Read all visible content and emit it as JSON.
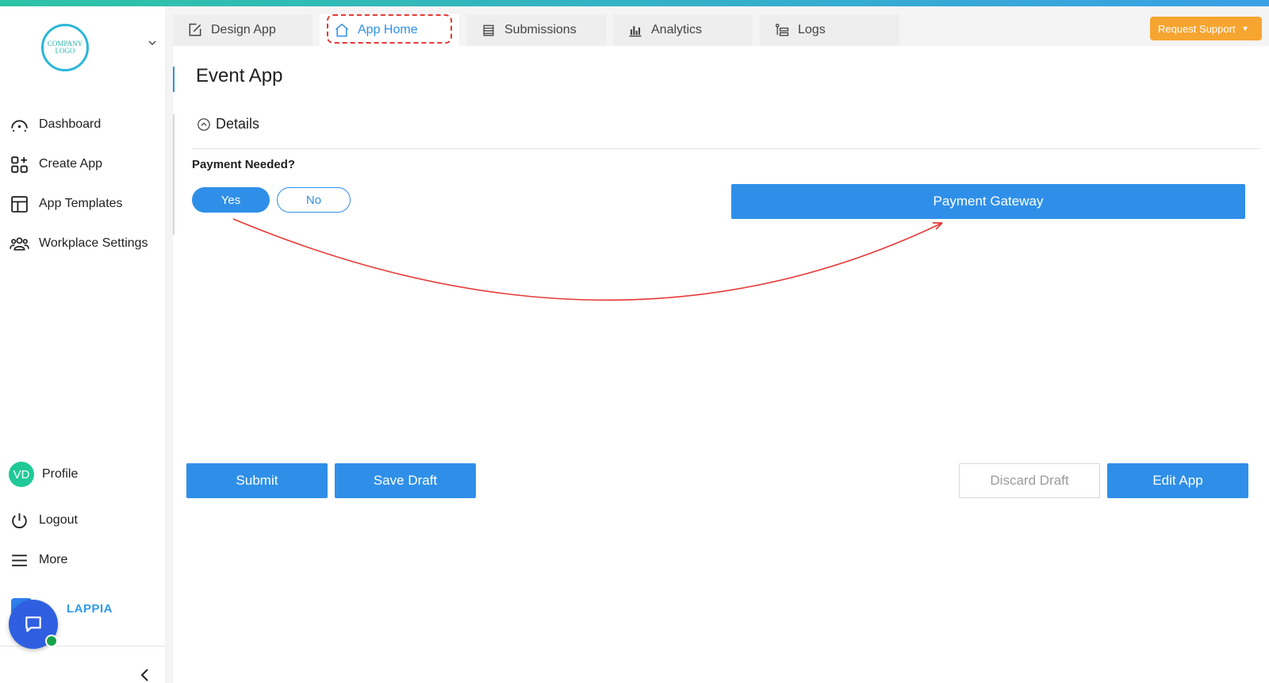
{
  "sidebar": {
    "logo_text": "COMPANY LOGO",
    "items": [
      {
        "label": "Dashboard",
        "icon": "gauge-icon"
      },
      {
        "label": "Create App",
        "icon": "grid-plus-icon"
      },
      {
        "label": "App Templates",
        "icon": "layout-template-icon"
      },
      {
        "label": "Workplace Settings",
        "icon": "users-group-icon"
      }
    ],
    "bottom_items": [
      {
        "label": "Profile",
        "avatar_initials": "VD"
      },
      {
        "label": "Logout",
        "icon": "power-icon"
      },
      {
        "label": "More",
        "icon": "hamburger-icon"
      }
    ],
    "brand": "LAPPIA"
  },
  "tabs": [
    {
      "label": "Design App",
      "icon": "edit-icon"
    },
    {
      "label": "App Home",
      "icon": "home-icon",
      "active": true
    },
    {
      "label": "Submissions",
      "icon": "list-icon"
    },
    {
      "label": "Analytics",
      "icon": "bar-chart-icon"
    },
    {
      "label": "Logs",
      "icon": "logs-icon"
    }
  ],
  "header": {
    "request_support": "Request Support"
  },
  "main": {
    "title": "Event App",
    "section": "Details",
    "field_label": "Payment Needed?",
    "yes": "Yes",
    "no": "No",
    "gateway": "Payment Gateway"
  },
  "actions": {
    "submit": "Submit",
    "save_draft": "Save Draft",
    "discard_draft": "Discard Draft",
    "edit_app": "Edit App"
  },
  "colors": {
    "accent": "#2f8fe8",
    "warning": "#f6a531",
    "annotation": "#e53935"
  }
}
